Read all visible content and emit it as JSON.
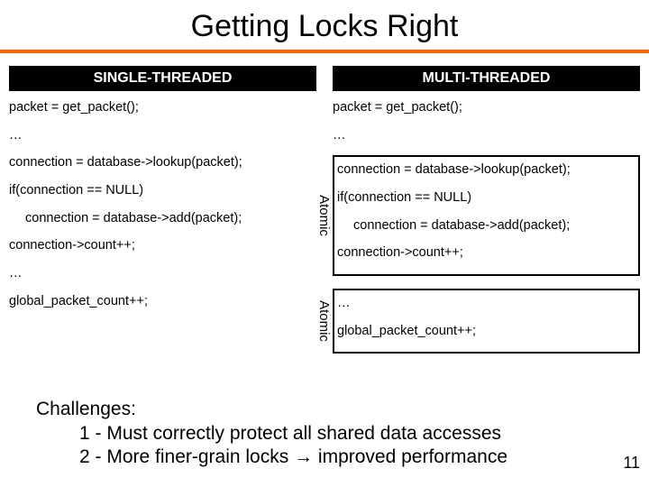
{
  "title": "Getting Locks Right",
  "left": {
    "header": "SINGLE-THREADED",
    "lines": {
      "l1": "packet = get_packet();",
      "l2": "…",
      "l3": "connection = database->lookup(packet);",
      "l4": "if(connection == NULL)",
      "l5": "connection = database->add(packet);",
      "l6": "connection->count++;",
      "l7": "…",
      "l8": "global_packet_count++;"
    }
  },
  "right": {
    "header": "MULTI-THREADED",
    "atomic_label": "Atomic",
    "lines": {
      "l1": "packet = get_packet();",
      "l2": "…",
      "l3": "connection = database->lookup(packet);",
      "l4": "if(connection == NULL)",
      "l5": "connection = database->add(packet);",
      "l6": "connection->count++;",
      "l7": "…",
      "l8": "global_packet_count++;"
    }
  },
  "challenges": {
    "title": "Challenges:",
    "item1_pre": "1 - Must correctly protect all shared data accesses",
    "item2_pre": "2 - More finer-grain locks ",
    "arrow": "→",
    "item2_post": " improved performance"
  },
  "page_number": "11"
}
